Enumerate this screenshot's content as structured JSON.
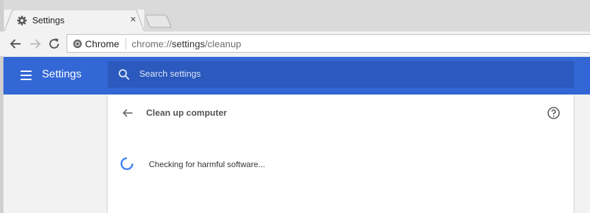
{
  "browser": {
    "tab": {
      "title": "Settings",
      "icon": "gear-icon",
      "close_label": "×"
    },
    "omnibox": {
      "site_label": "Chrome",
      "url_prefix": "chrome://",
      "url_host": "settings",
      "url_path": "/cleanup"
    }
  },
  "settings": {
    "header_title": "Settings",
    "search_placeholder": "Search settings"
  },
  "cleanup": {
    "title": "Clean up computer",
    "status": "Checking for harmful software..."
  },
  "colors": {
    "header_blue": "#3367d6",
    "search_blue": "#2b59bd",
    "spinner_blue": "#4285f4"
  }
}
